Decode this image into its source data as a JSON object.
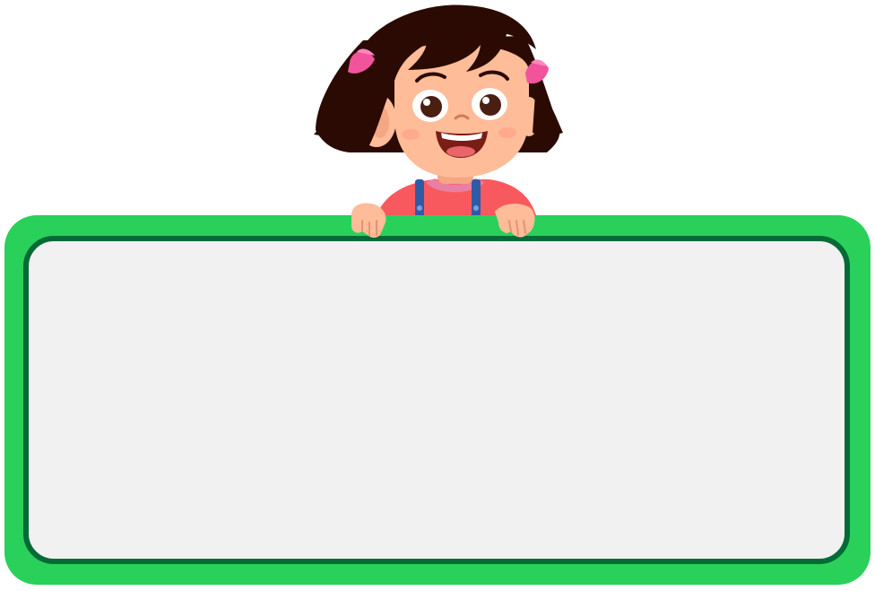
{
  "scene": {
    "background": "#ffffff",
    "board": {
      "outer_color": "#29d15a",
      "border_color": "#046a36",
      "fill_color": "#f1f1f1",
      "text": ""
    },
    "character": {
      "icon": "girl-peeking-icon",
      "hair_color": "#2b0a04",
      "skin_color": "#ffbc98",
      "bow_color": "#f2549c",
      "shirt_color": "#f8595f",
      "strap_color": "#2e5ba6"
    }
  }
}
